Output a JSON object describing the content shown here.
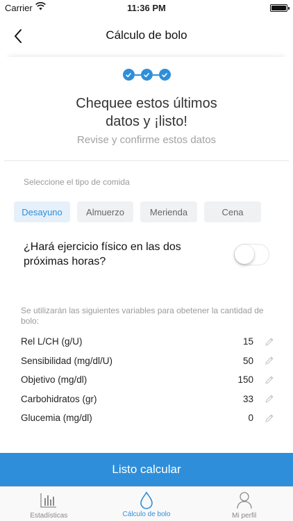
{
  "status_bar": {
    "carrier": "Carrier",
    "time": "11:36 PM"
  },
  "nav": {
    "title": "Cálculo de bolo",
    "back_icon": "chevron-left-icon"
  },
  "progress": {
    "steps_completed": 3,
    "steps_total": 3
  },
  "header": {
    "headline_line1": "Chequee estos últimos",
    "headline_line2": "datos y ¡listo!",
    "subtitle": "Revise y confirme estos datos"
  },
  "meal": {
    "label": "Seleccione el tipo de comida",
    "options": [
      "Desayuno",
      "Almuerzo",
      "Merienda",
      "Cena"
    ],
    "selected": "Desayuno"
  },
  "exercise": {
    "question": "¿Hará ejercicio físico en las dos próximas horas?",
    "enabled": false
  },
  "variables": {
    "note": "Se utilizarán las siguientes variables para obetener la cantidad de bolo:",
    "rows": [
      {
        "label": "Rel L/CH (g/U)",
        "value": "15"
      },
      {
        "label": "Sensibilidad (mg/dl/U)",
        "value": "50"
      },
      {
        "label": "Objetivo (mg/dl)",
        "value": "150"
      },
      {
        "label": "Carbohidratos (gr)",
        "value": "33"
      },
      {
        "label": "Glucemia (mg/dl)",
        "value": "0"
      }
    ]
  },
  "cta": {
    "label": "Listo calcular"
  },
  "tabs": [
    {
      "label": "Estadísticas",
      "icon": "bar-chart-icon",
      "active": false
    },
    {
      "label": "Cálculo de bolo",
      "icon": "drop-icon",
      "active": true
    },
    {
      "label": "Mi perfil",
      "icon": "person-icon",
      "active": false
    }
  ],
  "colors": {
    "accent": "#2f8ed9",
    "chip_bg": "#f0f1f3",
    "chip_active_bg": "#e5f0fa",
    "muted_text": "#9a9a9a"
  }
}
